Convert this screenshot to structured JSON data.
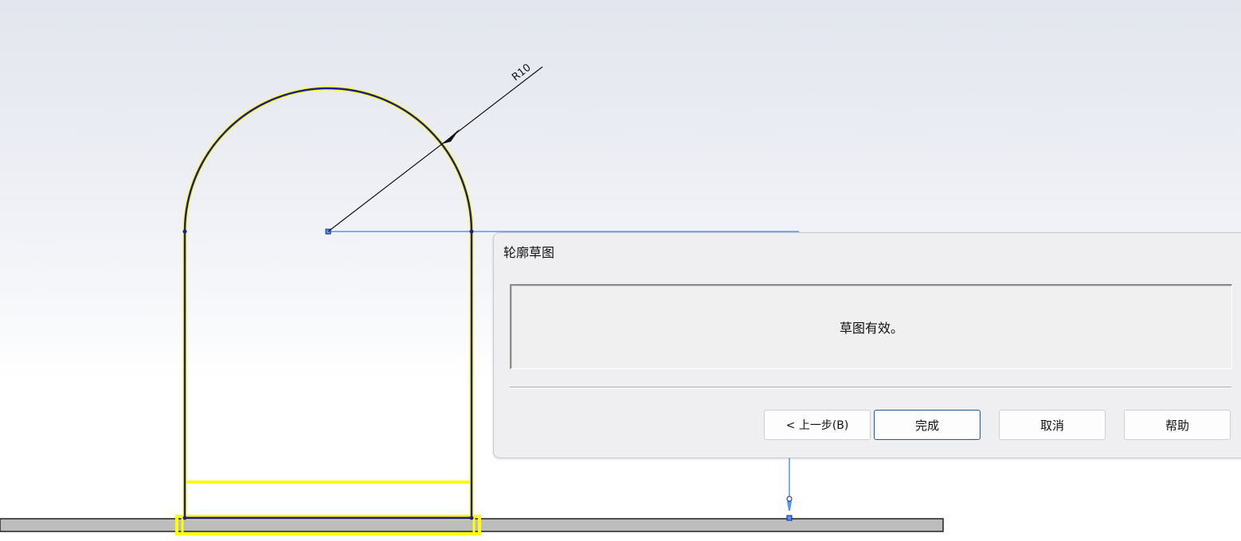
{
  "sketch": {
    "radius_dimension_label": "R10"
  },
  "dialog": {
    "title": "轮廓草图",
    "message": "草图有效。",
    "buttons": {
      "back": "< 上一步(B)",
      "finish": "完成",
      "cancel": "取消",
      "help": "帮助"
    }
  },
  "colors": {
    "sketch_line": "#1a1a9e",
    "highlight": "#ffff00",
    "construction_line": "#4a9cf0",
    "ground_bar": "#bdbdbd",
    "primary_button_border": "#2d5d8f"
  }
}
